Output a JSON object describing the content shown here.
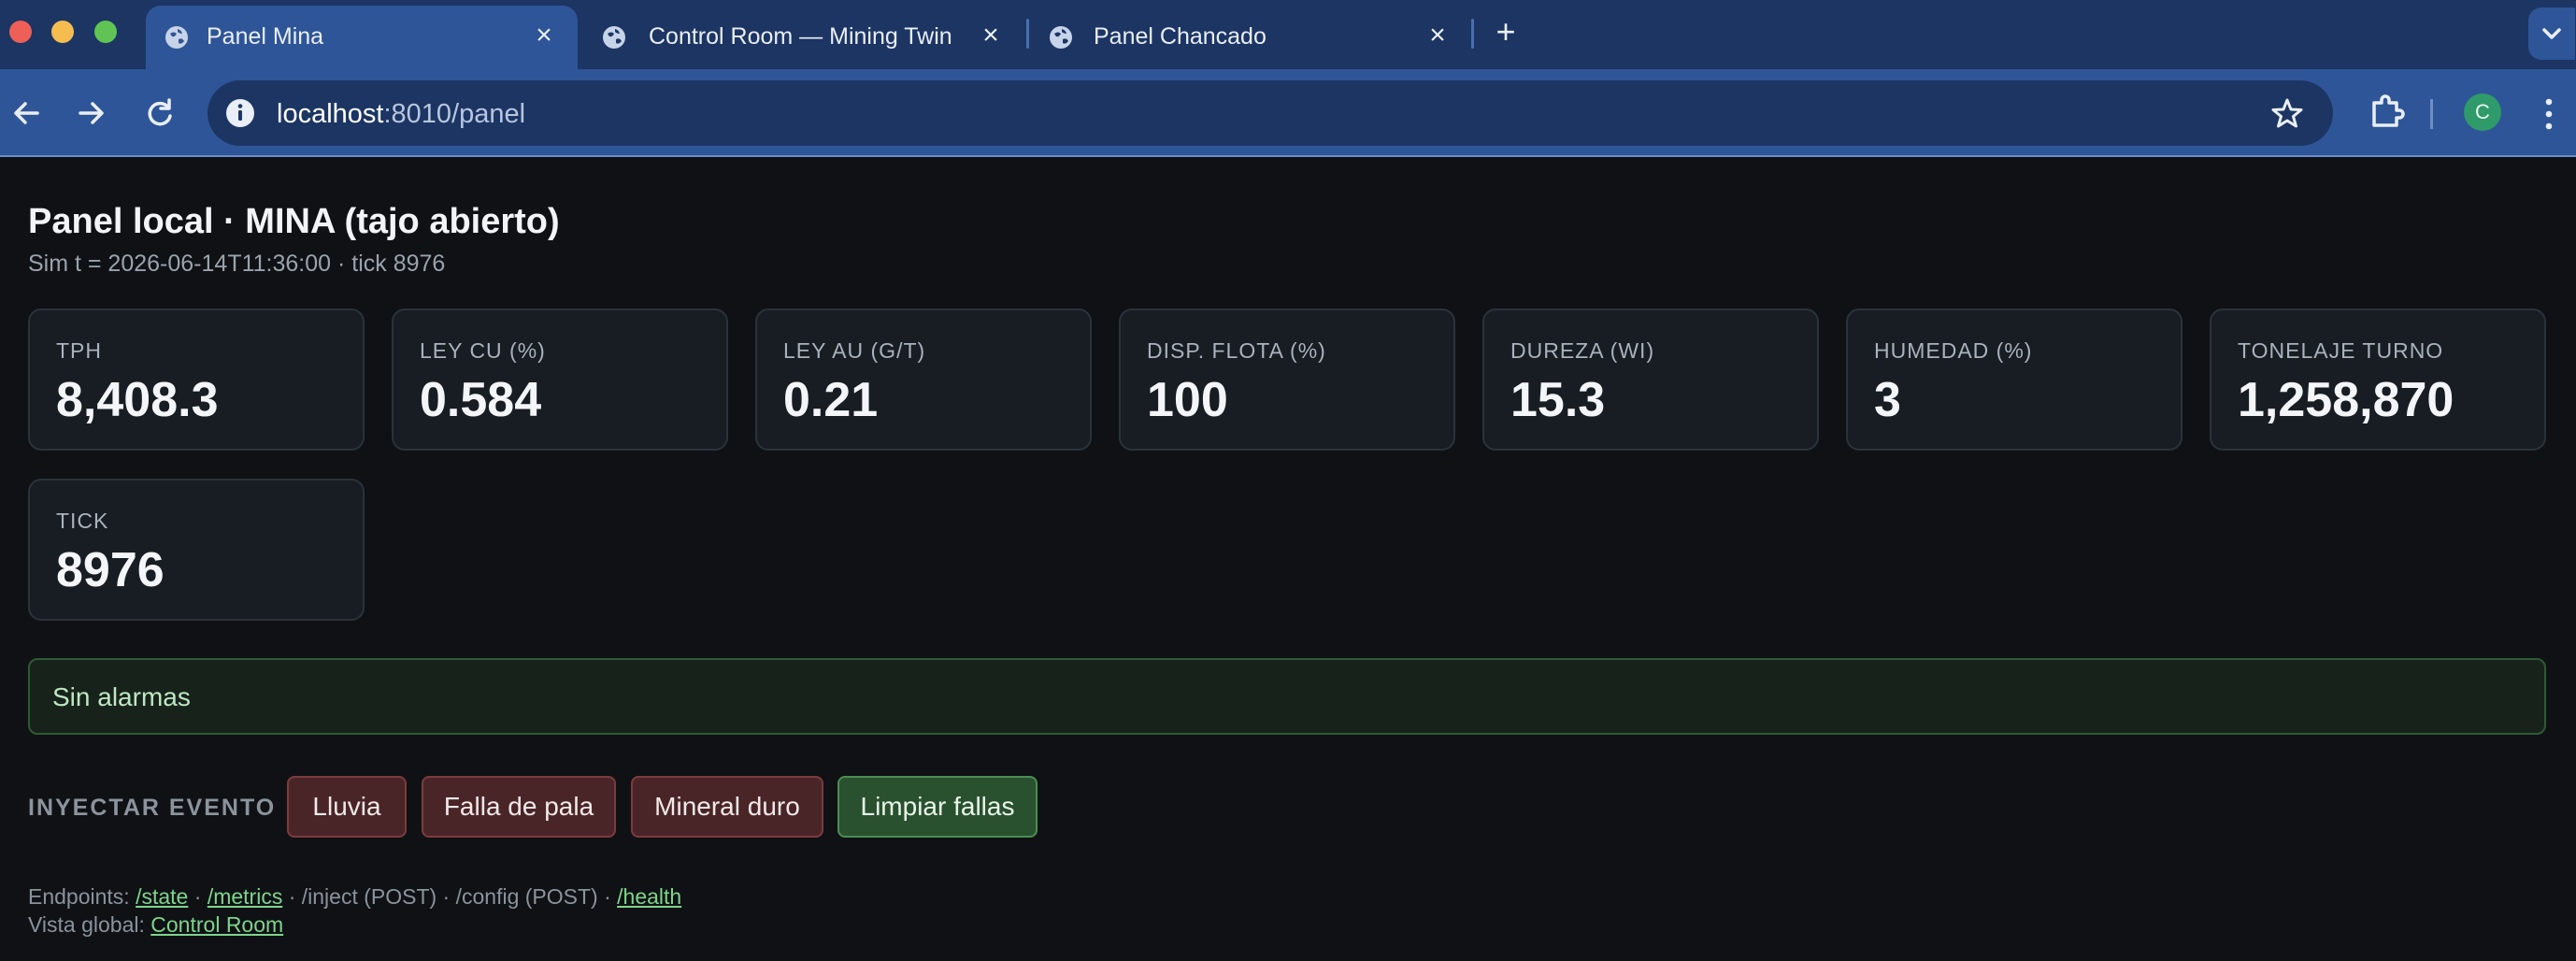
{
  "browser": {
    "tabs": [
      {
        "title": "Panel Mina",
        "active": true
      },
      {
        "title": "Control Room — Mining Twin",
        "active": false
      },
      {
        "title": "Panel Chancado",
        "active": false
      }
    ],
    "url_host": "localhost",
    "url_rest": ":8010/panel",
    "profile_initial": "C",
    "icons": [
      "globe-icon",
      "close-icon",
      "plus-icon",
      "chevron-down-icon",
      "back-arrow-icon",
      "forward-arrow-icon",
      "reload-icon",
      "info-icon",
      "star-icon",
      "extensions-icon",
      "kebab-menu-icon"
    ]
  },
  "header": {
    "title": "Panel local · MINA (tajo abierto)",
    "subtitle": "Sim t = 2026-06-14T11:36:00 · tick 8976"
  },
  "metrics": [
    {
      "label": "TPH",
      "value": "8,408.3"
    },
    {
      "label": "LEY CU (%)",
      "value": "0.584"
    },
    {
      "label": "LEY AU (G/T)",
      "value": "0.21"
    },
    {
      "label": "DISP. FLOTA (%)",
      "value": "100"
    },
    {
      "label": "DUREZA (WI)",
      "value": "15.3"
    },
    {
      "label": "HUMEDAD (%)",
      "value": "3"
    },
    {
      "label": "TONELAJE TURNO",
      "value": "1,258,870"
    },
    {
      "label": "TICK",
      "value": "8976"
    }
  ],
  "alarm": {
    "text": "Sin alarmas",
    "color": "#2f5a34"
  },
  "inject": {
    "label": "INYECTAR EVENTO",
    "buttons": [
      {
        "label": "Lluvia",
        "kind": "danger"
      },
      {
        "label": "Falla de pala",
        "kind": "danger"
      },
      {
        "label": "Mineral duro",
        "kind": "danger"
      },
      {
        "label": "Limpiar fallas",
        "kind": "success"
      }
    ]
  },
  "footer": {
    "endpoints_prefix": "Endpoints:",
    "link_state": "/state",
    "sep1": " · ",
    "link_metrics": "/metrics",
    "inject_text": " · /inject (POST) · /config (POST) · ",
    "link_health": "/health",
    "global_prefix": "Vista global:",
    "link_control_room": "Control Room"
  },
  "colors": {
    "page_bg": "#0f1115",
    "card_bg": "#181c23",
    "chrome_tab_bg": "#1c3563",
    "chrome_toolbar_bg": "#2e5597",
    "link": "#7fd48b",
    "danger_button": "#4a2527",
    "success_button": "#29512f"
  }
}
